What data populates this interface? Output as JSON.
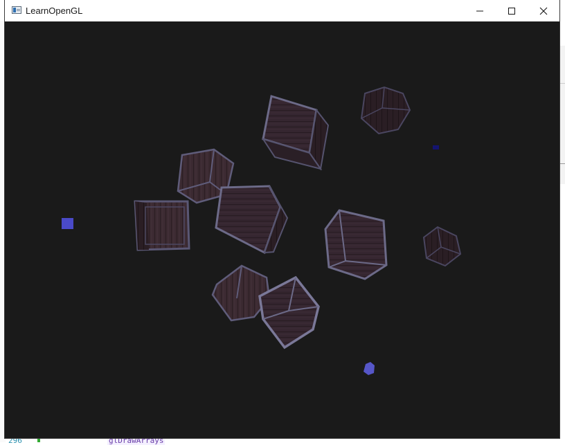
{
  "window": {
    "title": "LearnOpenGL",
    "icon": "opengl-app-icon",
    "controls": [
      "minimize-icon",
      "maximize-icon",
      "close-icon"
    ]
  },
  "scene": {
    "background_color": "#1a1a1a",
    "object_kinds": [
      "textured-wooden-crate",
      "light-source-cube"
    ],
    "light_color": "#4040c0"
  },
  "background_app": {
    "line_number": "296",
    "code_snippet": "glDrawArrays"
  },
  "colors": {
    "crate_wood": "#3a2a30",
    "crate_edge": "#6a6a8a",
    "light": "#4a4ac8"
  }
}
